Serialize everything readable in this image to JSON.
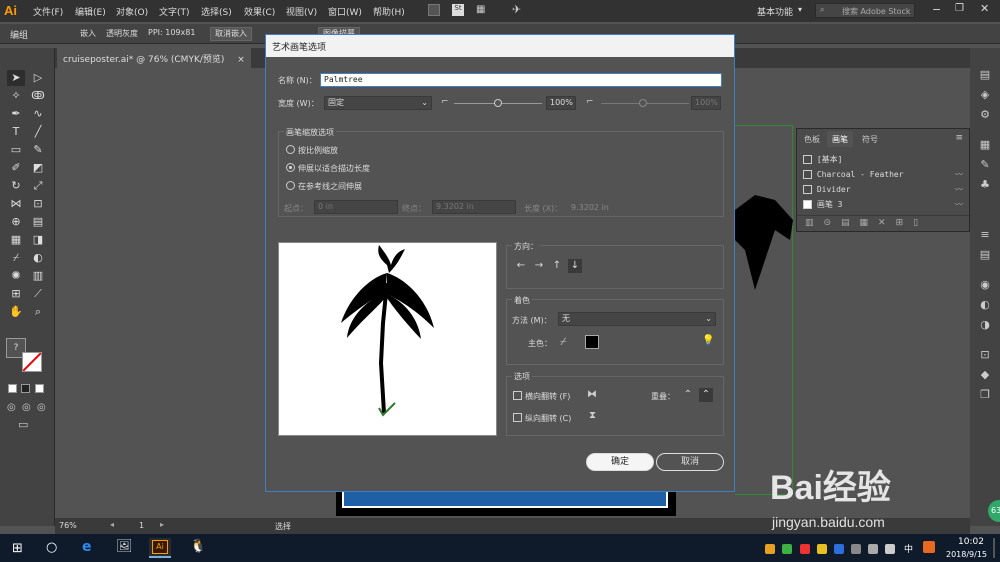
{
  "app": {
    "logo": "Ai",
    "menus": [
      "文件(F)",
      "编辑(E)",
      "对象(O)",
      "文字(T)",
      "选择(S)",
      "效果(C)",
      "视图(V)",
      "窗口(W)",
      "帮助(H)"
    ],
    "workspace": "基本功能",
    "search_placeholder": "搜索 Adobe Stock"
  },
  "control_bar": {
    "label": "编组",
    "embed": "嵌入",
    "transparency": "透明灰度",
    "ppi": "PPI: 109x81",
    "unembed": "取消嵌入",
    "trace_menu": "图像描摹"
  },
  "doc_tab": {
    "title": "cruiseposter.ai* @ 76% (CMYK/预览)",
    "close": "×"
  },
  "status": {
    "zoom": "76%",
    "page": "1",
    "tool": "选择"
  },
  "brush_panel": {
    "tabs": [
      "色板",
      "画笔",
      "符号"
    ],
    "items": [
      "[基本]",
      "Charcoal - Feather",
      "Divider",
      "画笔 3"
    ]
  },
  "dialog": {
    "title": "艺术画笔选项",
    "name_label": "名称 (N)：",
    "name_value": "Palmtree",
    "width_label": "宽度 (W)：",
    "width_value": "固定",
    "width_pct": "100%",
    "width_pct2": "100%",
    "scale_group": "画笔缩放选项",
    "opt_proportional": "按比例缩放",
    "opt_stretch": "伸展以适合描边长度",
    "opt_guides": "在参考线之间伸展",
    "start_label": "起点：",
    "start_value": "0 in",
    "end_label": "终点：",
    "end_value": "9.3202 in",
    "length_label": "长度 (X)：",
    "length_value": "9.3202 in",
    "direction_label": "方向：",
    "color_label": "着色",
    "method_label": "方法 (M)：",
    "method_value": "无",
    "key_color_label": "主色：",
    "options_label": "选项",
    "flip_h": "横向翻转 (F)",
    "flip_v": "纵向翻转 (C)",
    "overlap_label": "重叠：",
    "ok": "确定",
    "cancel": "取消"
  },
  "taskbar": {
    "time": "10:02",
    "date": "2018/9/15",
    "ime": "中",
    "app_label": "Ai"
  },
  "watermark": {
    "brand": "Bai经验",
    "url": "jingyan.baidu.com"
  },
  "colors": {
    "accent": "#3d7fc5",
    "ai_orange": "#ff9a00"
  }
}
